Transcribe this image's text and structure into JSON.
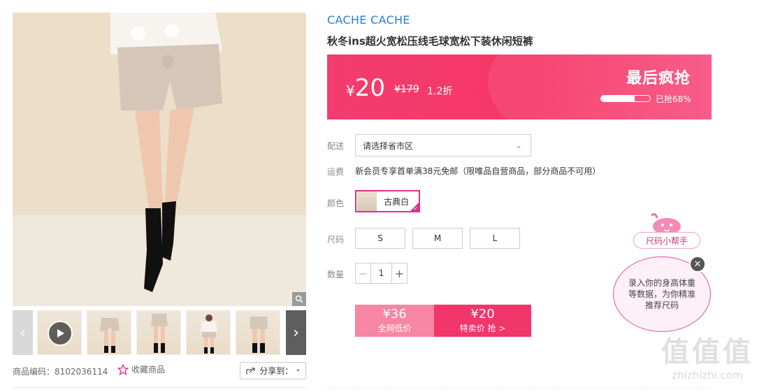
{
  "product": {
    "brand": "CACHE CACHE",
    "title": "秋冬ins超火宽松压线毛球宽松下装休闲短裤"
  },
  "price_banner": {
    "currency": "¥",
    "price": "20",
    "original_price": "¥179",
    "discount": "1.2折",
    "promo_title": "最后疯抢",
    "sold_label": "已抢68%",
    "sold_fraction": 0.68
  },
  "delivery": {
    "label": "配送",
    "placeholder": "请选择省市区"
  },
  "shipping": {
    "label": "运费",
    "text": "新会员专享首单满38元免邮（限唯品自营商品，部分商品不可用）"
  },
  "color": {
    "label": "颜色",
    "selected": "古典白"
  },
  "size": {
    "label": "尺码",
    "options": [
      "S",
      "M",
      "L"
    ]
  },
  "quantity": {
    "label": "数量",
    "value": "1",
    "minus": "−",
    "plus": "+"
  },
  "buy": {
    "market_price": "¥36",
    "market_label": "全网低价",
    "special_price": "¥20",
    "special_label": "特卖价 抢 >"
  },
  "gallery": {
    "thumbnails": 6
  },
  "meta": {
    "sku": "商品编码：8102036114",
    "favorite": "收藏商品",
    "share": "分享到："
  },
  "size_helper": {
    "label": "尺码小帮手",
    "bubble": "录入你的身高体重等数据，为你精准推荐尺码",
    "close": "✕"
  },
  "watermark": {
    "main": "值值值",
    "sub": "zhizhizhi.com"
  },
  "colors": {
    "accent": "#f0366b",
    "brand_link": "#2a7fd4",
    "swatch_border": "#d9318e"
  }
}
